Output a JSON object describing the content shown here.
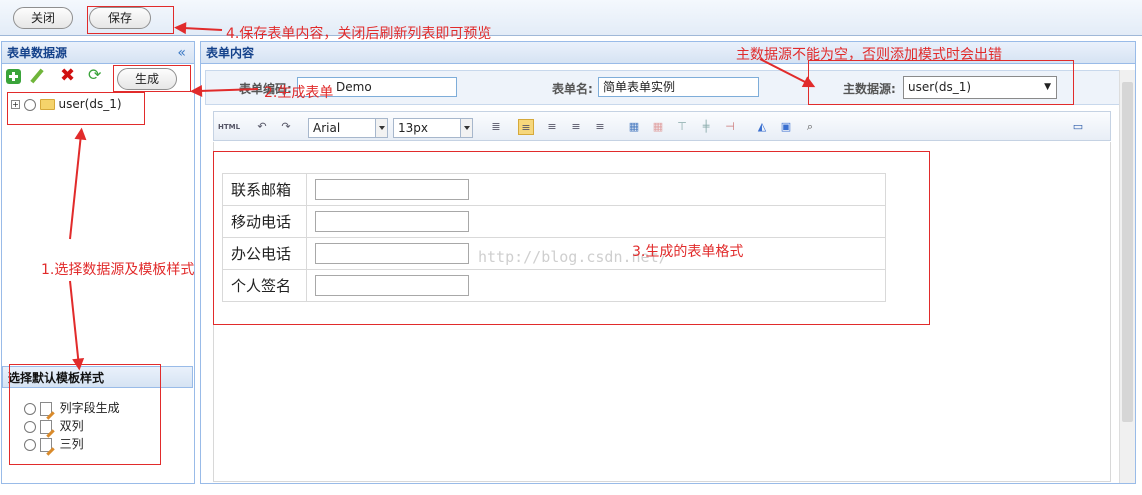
{
  "topbar": {
    "close_label": "关闭",
    "save_label": "保存"
  },
  "left_panel": {
    "title": "表单数据源",
    "collapse_glyph": "«",
    "tools": {
      "add_icon": "add-icon",
      "edit_icon": "pencil-icon",
      "delete_icon": "delete-x-icon",
      "refresh_icon": "refresh-icon"
    },
    "generate_label": "生成",
    "tree": [
      {
        "label": "user(ds_1)"
      }
    ]
  },
  "template_panel": {
    "title": "选择默认模板样式",
    "options": [
      {
        "label": "列字段生成"
      },
      {
        "label": "双列"
      },
      {
        "label": "三列"
      }
    ]
  },
  "main_panel": {
    "title": "表单内容",
    "form_code_label": "表单编码:",
    "form_code_value": "Demo",
    "form_name_label": "表单名:",
    "form_name_value": "简单表单实例",
    "datasource_label": "主数据源:",
    "datasource_value": "user(ds_1)"
  },
  "editor_toolbar": {
    "html_label": "HTML",
    "font_family": "Arial",
    "font_size": "13px"
  },
  "generated_form": {
    "rows": [
      {
        "label": "联系邮箱"
      },
      {
        "label": "移动电话"
      },
      {
        "label": "办公电话"
      },
      {
        "label": "个人签名"
      }
    ]
  },
  "watermark": "http://blog.csdn.net/",
  "annotations": {
    "a1": "1.选择数据源及模板样式",
    "a2": "2.生成表单",
    "a3": "3.生成的表单格式",
    "a4": "4.保存表单内容，关闭后刷新列表即可预览",
    "a5": "主数据源不能为空，否则添加模式时会出错"
  },
  "colors": {
    "annotation": "#e12b2b",
    "panel_border": "#99bbe8",
    "panel_title": "#15428b"
  }
}
